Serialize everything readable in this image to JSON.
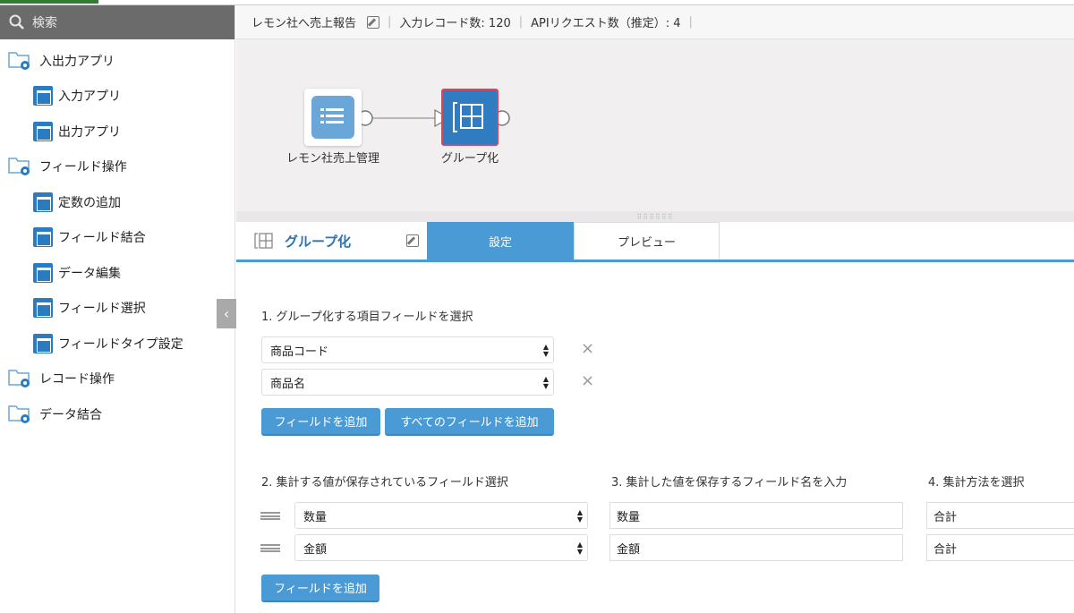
{
  "sidebar": {
    "search_placeholder": "検索",
    "items": [
      {
        "label": "入出力アプリ",
        "type": "folder"
      },
      {
        "label": "入力アプリ",
        "type": "child"
      },
      {
        "label": "出力アプリ",
        "type": "child"
      },
      {
        "label": "フィールド操作",
        "type": "folder"
      },
      {
        "label": "定数の追加",
        "type": "child"
      },
      {
        "label": "フィールド結合",
        "type": "child"
      },
      {
        "label": "データ編集",
        "type": "child"
      },
      {
        "label": "フィールド選択",
        "type": "child"
      },
      {
        "label": "フィールドタイプ設定",
        "type": "child"
      },
      {
        "label": "レコード操作",
        "type": "folder"
      },
      {
        "label": "データ結合",
        "type": "folder"
      }
    ],
    "collapse_glyph": "‹"
  },
  "header": {
    "title": "レモン社へ売上報告",
    "input_records": "入力レコード数: 120",
    "api_requests": "APIリクエスト数（推定）: 4"
  },
  "canvas": {
    "grip": "⠿⠿⠿⠿⠿⠿",
    "nodes": [
      {
        "label": "レモン社売上管理",
        "icon": "list-icon"
      },
      {
        "label": "グループ化",
        "icon": "group-icon"
      }
    ]
  },
  "panel": {
    "title": "グループ化",
    "tabs": {
      "settings": "設定",
      "preview": "プレビュー"
    },
    "section1": {
      "label": "1. グループ化する項目フィールドを選択",
      "fields": [
        "商品コード",
        "商品名"
      ],
      "add_button": "フィールドを追加",
      "add_all_button": "すべてのフィールドを追加"
    },
    "section2": {
      "label": "2. 集計する値が保存されているフィールド選択",
      "fields": [
        "数量",
        "金額"
      ],
      "add_button": "フィールドを追加"
    },
    "section3": {
      "label": "3. 集計した値を保存するフィールド名を入力",
      "values": [
        "数量",
        "金額"
      ]
    },
    "section4": {
      "label": "4. 集計方法を選択",
      "values": [
        "合計",
        "合計"
      ]
    }
  },
  "colors": {
    "accent": "#4a9ad6",
    "sidebar_search": "#6b6b6b",
    "canvas_bg": "#f1efef",
    "selected_node_border": "#d9455f"
  }
}
